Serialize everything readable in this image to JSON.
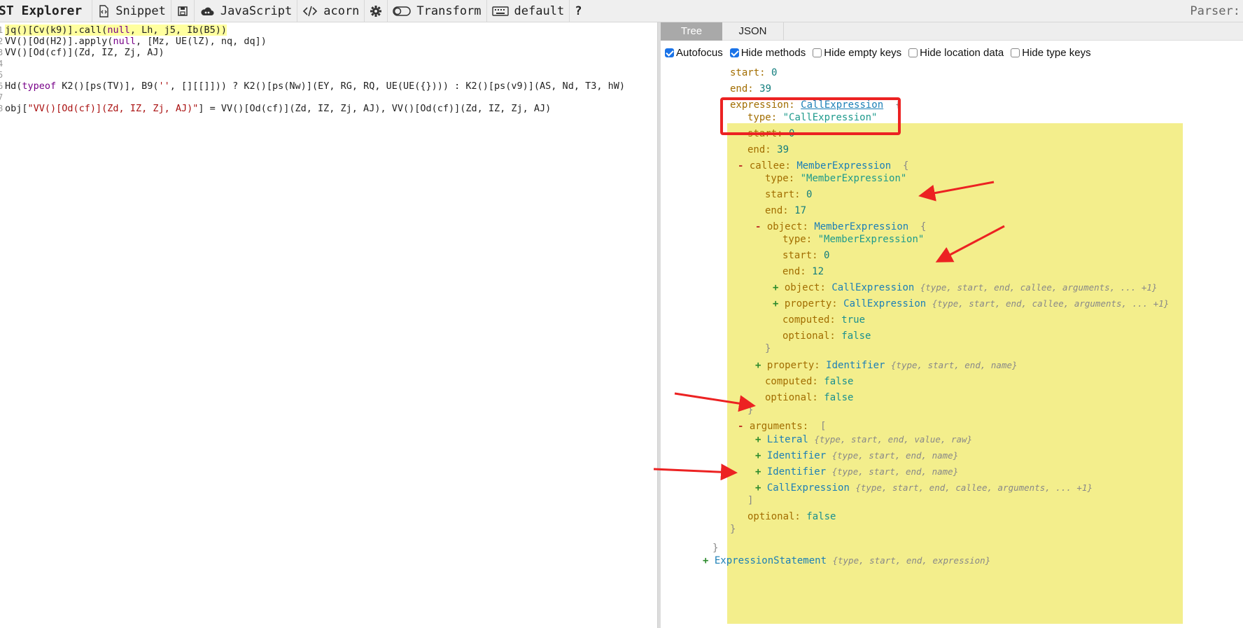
{
  "toolbar": {
    "title": "ST Explorer",
    "snippet_label": "Snippet",
    "language_label": "JavaScript",
    "parser_name": "acorn",
    "transform_label": "Transform",
    "keymap_label": "default",
    "help_label": "?",
    "parser_info": "Parser:"
  },
  "editor": {
    "lines": [
      {
        "num": "1",
        "text": "jq()[Cv(k9)].call(null, Lh, j5, Ib(B5))"
      },
      {
        "num": "2",
        "text": "VV()[Od(H2)].apply(null, [Mz, UE(lZ), nq, dq])"
      },
      {
        "num": "3",
        "text": "VV()[Od(cf)](Zd, IZ, Zj, AJ)"
      },
      {
        "num": "4",
        "text": ""
      },
      {
        "num": "5",
        "text": ""
      },
      {
        "num": "6",
        "text": "Hd(typeof K2()[ps(TV)], B9('', [][[]])) ? K2()[ps(Nw)](EY, RG, RQ, UE(UE({}))) : K2()[ps(v9)](AS, Nd, T3, hW)"
      },
      {
        "num": "7",
        "text": ""
      },
      {
        "num": "8",
        "text": "obj[\"VV()[Od(cf)](Zd, IZ, Zj, AJ)\"] = VV()[Od(cf)](Zd, IZ, Zj, AJ), VV()[Od(cf)](Zd, IZ, Zj, AJ)"
      }
    ],
    "line6_parts": [
      "Hd(",
      "typeof",
      " K2()[ps(TV)], B9(",
      "''",
      ", [][[]])) ? K2()[ps(Nw)](EY, RG, RQ, UE(UE({}))) : K2()[ps(v9)](AS, Nd, T3, hW)"
    ],
    "line8_parts": [
      "obj[",
      "\"VV()[Od(cf)](Zd, IZ, Zj, AJ)\"",
      "] = VV()[Od(cf)](Zd, IZ, Zj, AJ), VV()[Od(cf)](Zd, IZ, Zj, AJ)"
    ],
    "line1_null": "null",
    "line2_null": "null"
  },
  "tabs": {
    "tree": "Tree",
    "json": "JSON"
  },
  "options": [
    {
      "label": "Autofocus",
      "checked": true
    },
    {
      "label": "Hide methods",
      "checked": true
    },
    {
      "label": "Hide empty keys",
      "checked": false
    },
    {
      "label": "Hide location data",
      "checked": false
    },
    {
      "label": "Hide type keys",
      "checked": false
    }
  ],
  "tree": {
    "start_key": "start:",
    "start_val": "0",
    "end_key": "end:",
    "end_val": "39",
    "expression_key": "expression:",
    "expression_type": "CallExpression",
    "type_key": "type:",
    "type_call": "\"CallExpression\"",
    "start2_val": "0",
    "end2_val": "39",
    "callee_key": "callee:",
    "callee_type": "MemberExpression",
    "callee_type_val": "\"MemberExpression\"",
    "callee_start": "0",
    "callee_end": "17",
    "object_key": "object:",
    "object_type": "MemberExpression",
    "object_type_val": "\"MemberExpression\"",
    "object_start": "0",
    "object_end": "12",
    "inner_object_key": "object:",
    "inner_object_type": "CallExpression",
    "inner_object_summary": "{type, start, end, callee, arguments, ... +1}",
    "inner_property_key": "property:",
    "inner_property_type": "CallExpression",
    "inner_property_summary": "{type, start, end, callee, arguments, ... +1}",
    "computed_key": "computed:",
    "inner_computed_val": "true",
    "optional_key": "optional:",
    "inner_optional_val": "false",
    "property_key": "property:",
    "property_type": "Identifier",
    "property_summary": "{type, start, end, name}",
    "callee_computed_val": "false",
    "callee_optional_val": "false",
    "arguments_key": "arguments:",
    "args": [
      {
        "type": "Literal",
        "summary": "{type, start, end, value, raw}"
      },
      {
        "type": "Identifier",
        "summary": "{type, start, end, name}"
      },
      {
        "type": "Identifier",
        "summary": "{type, start, end, name}"
      },
      {
        "type": "CallExpression",
        "summary": "{type, start, end, callee, arguments, ... +1}"
      }
    ],
    "expr_optional_val": "false",
    "next_type": "ExpressionStatement",
    "next_summary": "{type, start, end, expression}"
  },
  "colors": {
    "highlight": "#f3ee8c",
    "annotation": "#ec2222",
    "tab_active": "#a9a9a9"
  }
}
